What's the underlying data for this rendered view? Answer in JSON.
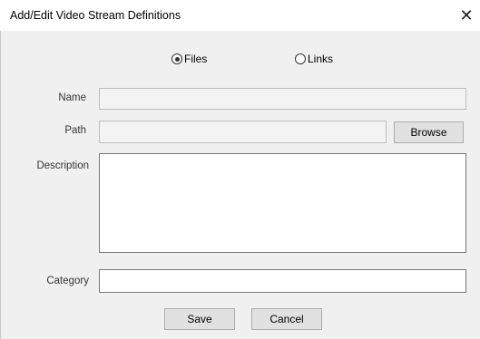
{
  "window": {
    "title": "Add/Edit Video Stream Definitions",
    "close_glyph": "✕"
  },
  "source_type": {
    "options": [
      {
        "label": "Files",
        "selected": true
      },
      {
        "label": "Links",
        "selected": false
      }
    ]
  },
  "form": {
    "name_label": "Name",
    "name_value": "",
    "path_label": "Path",
    "path_value": "",
    "browse_label": "Browse",
    "description_label": "Description",
    "description_value": "",
    "category_label": "Category",
    "category_value": ""
  },
  "actions": {
    "save_label": "Save",
    "cancel_label": "Cancel"
  }
}
